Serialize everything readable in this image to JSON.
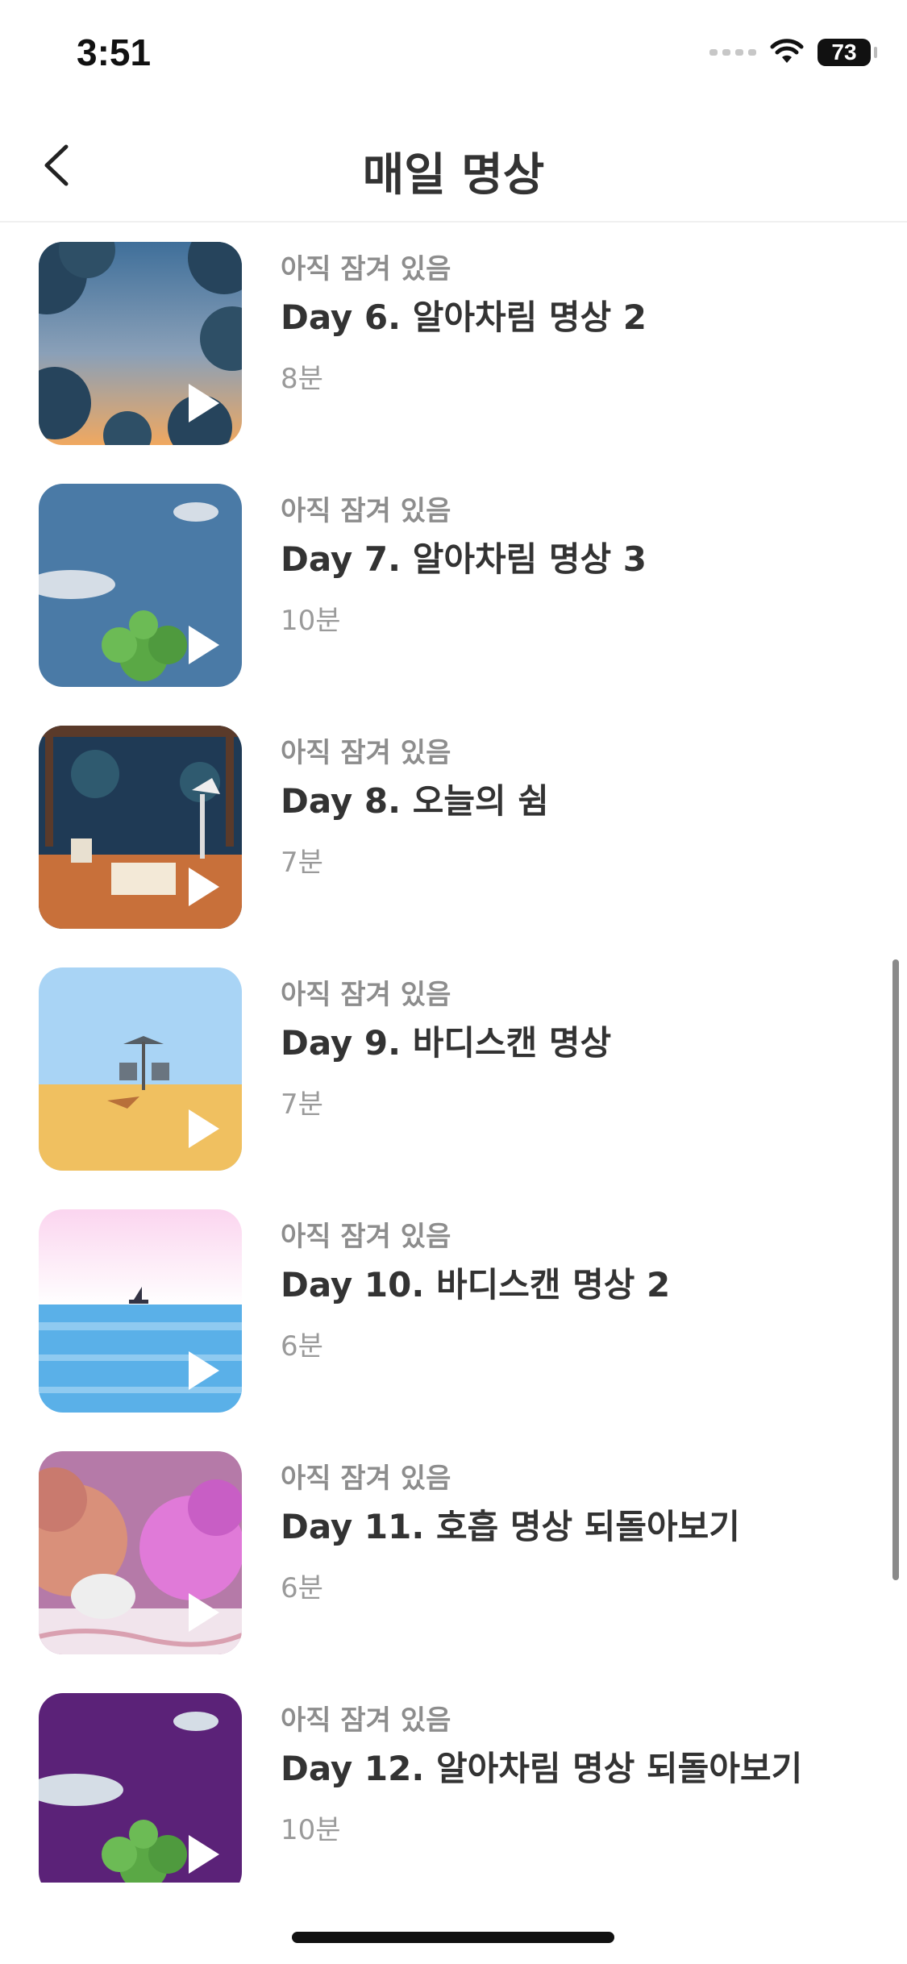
{
  "status_bar": {
    "time": "3:51",
    "battery": "73",
    "icons": [
      "signal-icon",
      "wifi-icon",
      "battery-icon"
    ]
  },
  "nav": {
    "title": "매일 명상",
    "back_icon": "chevron-left-icon"
  },
  "items": [
    {
      "status": "아직 잠겨 있음",
      "title": "Day 6. 알아차림 명상 2",
      "duration": "8분",
      "thumb": "sunset-trees"
    },
    {
      "status": "아직 잠겨 있음",
      "title": "Day 7. 알아차림 명상 3",
      "duration": "10분",
      "thumb": "blue-moon-plant"
    },
    {
      "status": "아직 잠겨 있음",
      "title": "Day 8. 오늘의 쉼",
      "duration": "7분",
      "thumb": "desk-lamp"
    },
    {
      "status": "아직 잠겨 있음",
      "title": "Day 9. 바디스캔 명상",
      "duration": "7분",
      "thumb": "beach-umbrella"
    },
    {
      "status": "아직 잠겨 있음",
      "title": "Day 10. 바디스캔 명상 2",
      "duration": "6분",
      "thumb": "sea-boat"
    },
    {
      "status": "아직 잠겨 있음",
      "title": "Day 11. 호흡 명상 되돌아보기",
      "duration": "6분",
      "thumb": "pink-trees"
    },
    {
      "status": "아직 잠겨 있음",
      "title": "Day 12. 알아차림 명상 되돌아보기",
      "duration": "10분",
      "thumb": "purple-moon-plant"
    }
  ],
  "colors": {
    "text": "#333333",
    "muted": "#8d8d8d",
    "divider": "#f0f0f0"
  }
}
